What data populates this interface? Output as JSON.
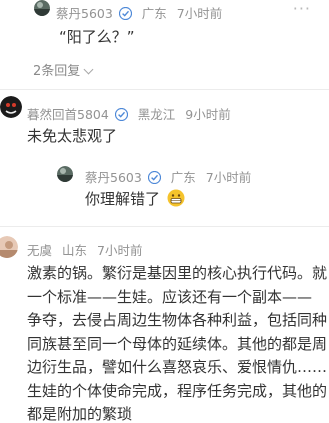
{
  "colors": {
    "meta": "#939393",
    "text": "#333333",
    "badge": "#4e89d8",
    "divider": "#ececec"
  },
  "comments": [
    {
      "user": "蔡丹5603",
      "verified": true,
      "location": "广东",
      "time": "7小时前",
      "text": "“阳了么？”",
      "more_icon": "more-dots-icon"
    },
    {
      "replies_label": "2条回复"
    },
    {
      "user": "暮然回首5804",
      "verified": true,
      "location": "黑龙江",
      "time": "9小时前",
      "text": "未免太悲观了"
    },
    {
      "user": "蔡丹5603",
      "verified": true,
      "location": "广东",
      "time": "7小时前",
      "text": "你理解错了",
      "emoji": "grin-icon"
    },
    {
      "user": "无虞",
      "location": "山东",
      "time": "7小时前",
      "text_lines": [
        "激素的锅。繁衍是基因里的核心执行代码。就",
        "一个标准——生娃。应该还有一个副本——",
        "争夺，去侵占周边生物体各种利益，包括同种",
        "同族甚至同一个母体的延续体。其他的都是周",
        "边衍生品，譬如什么喜怒哀乐、爱恨情仇……",
        "生娃的个体使命完成，程序任务完成，其他的",
        "都是附加的繁琐"
      ]
    }
  ]
}
